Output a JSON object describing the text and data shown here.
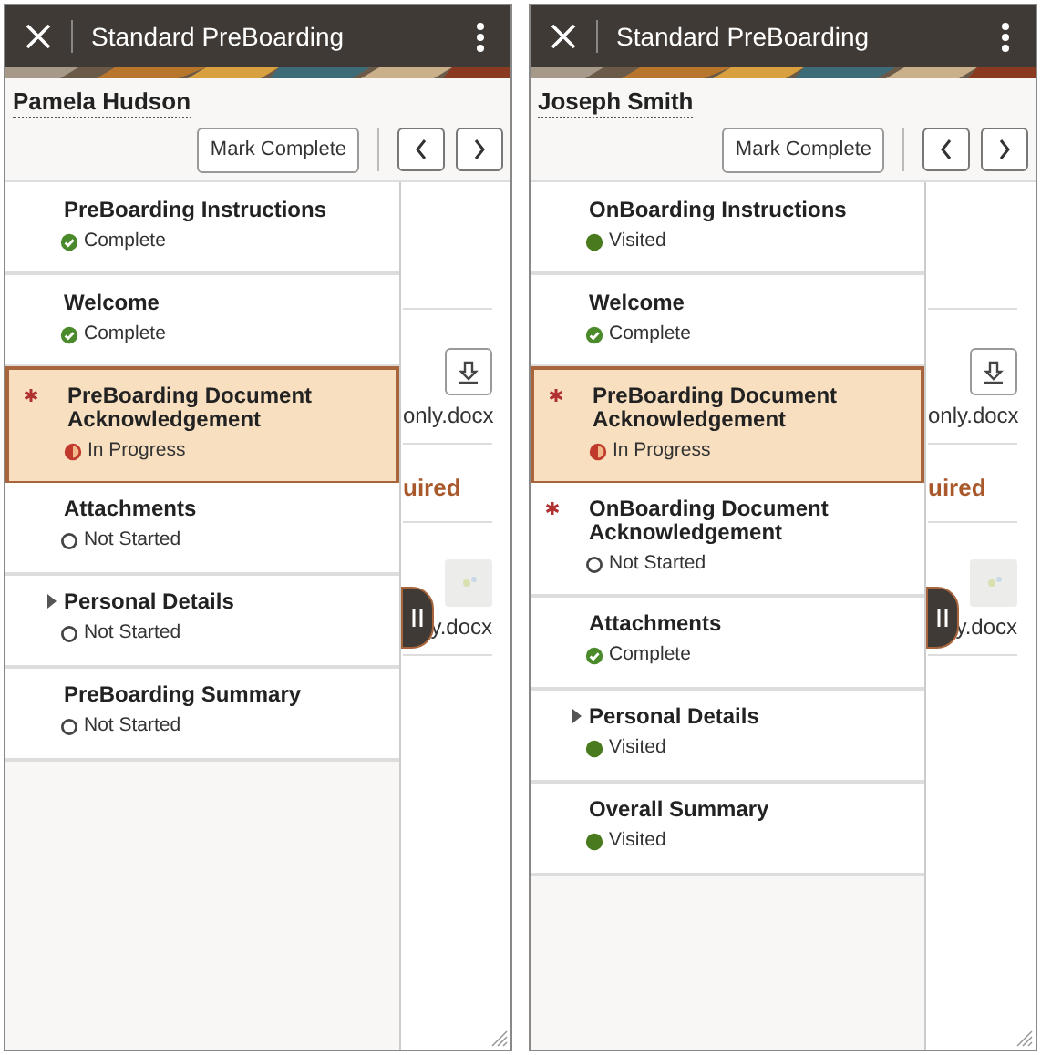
{
  "panels": [
    {
      "title": "Standard PreBoarding",
      "person": "Pamela Hudson",
      "action_button": "Mark Complete",
      "background": {
        "file_1": "only.docx",
        "heading": "uired",
        "file_2": "y.docx"
      },
      "steps": [
        {
          "label": "PreBoarding Instructions",
          "status": "Complete",
          "kind": "complete",
          "required": false,
          "selected": false,
          "expandable": false
        },
        {
          "label": "Welcome",
          "status": "Complete",
          "kind": "complete",
          "required": false,
          "selected": false,
          "expandable": false
        },
        {
          "label": "PreBoarding Document Acknowledgement",
          "status": "In Progress",
          "kind": "in_progress",
          "required": true,
          "selected": true,
          "expandable": false
        },
        {
          "label": "Attachments",
          "status": "Not Started",
          "kind": "not_started",
          "required": false,
          "selected": false,
          "expandable": false
        },
        {
          "label": "Personal Details",
          "status": "Not Started",
          "kind": "not_started",
          "required": false,
          "selected": false,
          "expandable": true
        },
        {
          "label": "PreBoarding Summary",
          "status": "Not Started",
          "kind": "not_started",
          "required": false,
          "selected": false,
          "expandable": false
        }
      ]
    },
    {
      "title": "Standard PreBoarding",
      "person": "Joseph Smith",
      "action_button": "Mark Complete",
      "background": {
        "file_1": "only.docx",
        "heading": "uired",
        "file_2": "y.docx"
      },
      "steps": [
        {
          "label": "OnBoarding Instructions",
          "status": "Visited",
          "kind": "visited",
          "required": false,
          "selected": false,
          "expandable": false
        },
        {
          "label": "Welcome",
          "status": "Complete",
          "kind": "complete",
          "required": false,
          "selected": false,
          "expandable": false
        },
        {
          "label": "PreBoarding Document Acknowledgement",
          "status": "In Progress",
          "kind": "in_progress",
          "required": true,
          "selected": true,
          "expandable": false
        },
        {
          "label": "OnBoarding Document Acknowledgement",
          "status": "Not Started",
          "kind": "not_started",
          "required": true,
          "selected": false,
          "expandable": false
        },
        {
          "label": "Attachments",
          "status": "Complete",
          "kind": "complete",
          "required": false,
          "selected": false,
          "expandable": false
        },
        {
          "label": "Personal Details",
          "status": "Visited",
          "kind": "visited",
          "required": false,
          "selected": false,
          "expandable": true
        },
        {
          "label": "Overall Summary",
          "status": "Visited",
          "kind": "visited",
          "required": false,
          "selected": false,
          "expandable": false
        }
      ]
    }
  ]
}
